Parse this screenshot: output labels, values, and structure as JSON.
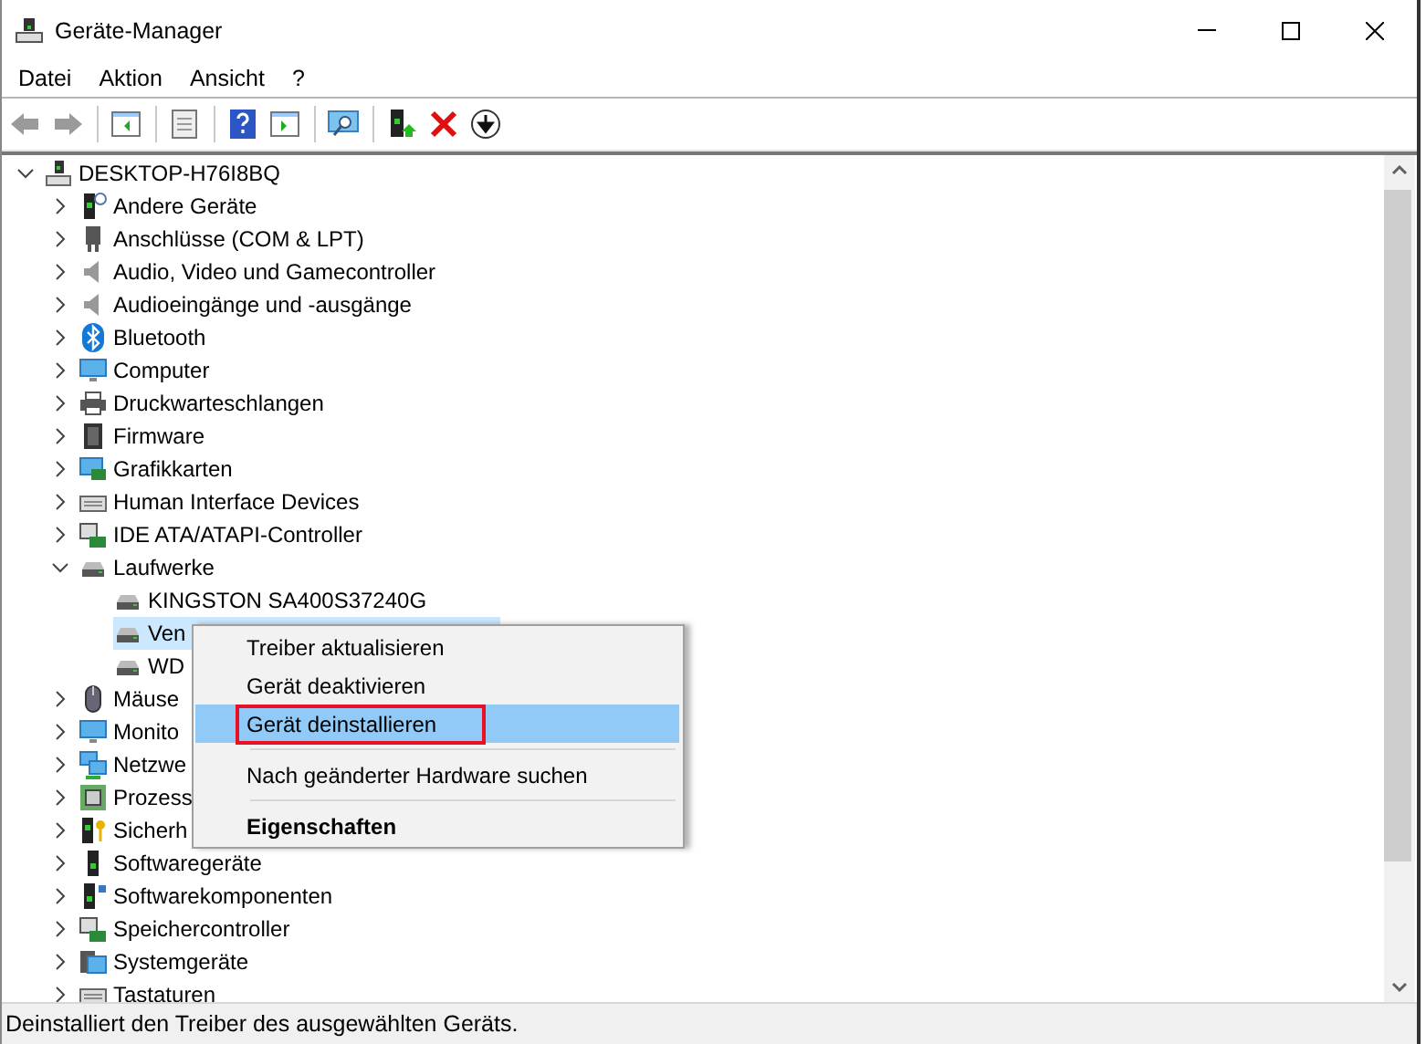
{
  "window": {
    "title": "Geräte-Manager"
  },
  "menu_bar": [
    {
      "label": "Datei"
    },
    {
      "label": "Aktion"
    },
    {
      "label": "Ansicht"
    },
    {
      "label": "?"
    }
  ],
  "tree": [
    {
      "label": "DESKTOP-H76I8BQ",
      "expanded": true,
      "selected": false,
      "children": [
        {
          "label": "Andere Geräte",
          "expanded": false,
          "selected": false
        },
        {
          "label": "Anschlüsse (COM & LPT)",
          "expanded": false,
          "selected": false
        },
        {
          "label": "Audio, Video und Gamecontroller",
          "expanded": false,
          "selected": false
        },
        {
          "label": "Audioeingänge und -ausgänge",
          "expanded": false,
          "selected": false
        },
        {
          "label": "Bluetooth",
          "expanded": false,
          "selected": false
        },
        {
          "label": "Computer",
          "expanded": false,
          "selected": false
        },
        {
          "label": "Druckwarteschlangen",
          "expanded": false,
          "selected": false
        },
        {
          "label": "Firmware",
          "expanded": false,
          "selected": false
        },
        {
          "label": "Grafikkarten",
          "expanded": false,
          "selected": false
        },
        {
          "label": "Human Interface Devices",
          "expanded": false,
          "selected": false
        },
        {
          "label": "IDE ATA/ATAPI-Controller",
          "expanded": false,
          "selected": false
        },
        {
          "label": "Laufwerke",
          "expanded": true,
          "selected": false,
          "children": [
            {
              "label": "KINGSTON SA400S37240G",
              "selected": false
            },
            {
              "label": "Ven",
              "selected": true
            },
            {
              "label": "WD",
              "selected": false
            }
          ]
        },
        {
          "label": "Mäuse",
          "expanded": false,
          "selected": false
        },
        {
          "label": "Monito",
          "expanded": false,
          "selected": false
        },
        {
          "label": "Netzwe",
          "expanded": false,
          "selected": false
        },
        {
          "label": "Prozess",
          "expanded": false,
          "selected": false
        },
        {
          "label": "Sicherh",
          "expanded": false,
          "selected": false
        },
        {
          "label": "Softwaregeräte",
          "expanded": false,
          "selected": false
        },
        {
          "label": "Softwarekomponenten",
          "expanded": false,
          "selected": false
        },
        {
          "label": "Speichercontroller",
          "expanded": false,
          "selected": false
        },
        {
          "label": "Systemgeräte",
          "expanded": false,
          "selected": false
        },
        {
          "label": "Tastaturen",
          "expanded": false,
          "selected": false
        }
      ]
    }
  ],
  "context_menu": [
    {
      "kind": "item",
      "label": "Treiber aktualisieren",
      "selected": false,
      "outlined": false,
      "default": false
    },
    {
      "kind": "item",
      "label": "Gerät deaktivieren",
      "selected": false,
      "outlined": false,
      "default": false
    },
    {
      "kind": "item",
      "label": "Gerät deinstallieren",
      "selected": true,
      "outlined": true,
      "default": false
    },
    {
      "kind": "separator"
    },
    {
      "kind": "item",
      "label": "Nach geänderter Hardware suchen",
      "selected": false,
      "outlined": false,
      "default": false
    },
    {
      "kind": "separator"
    },
    {
      "kind": "item",
      "label": "Eigenschaften",
      "selected": false,
      "outlined": false,
      "default": true
    }
  ],
  "status_bar": {
    "text": "Deinstalliert den Treiber des ausgewählten Geräts."
  }
}
